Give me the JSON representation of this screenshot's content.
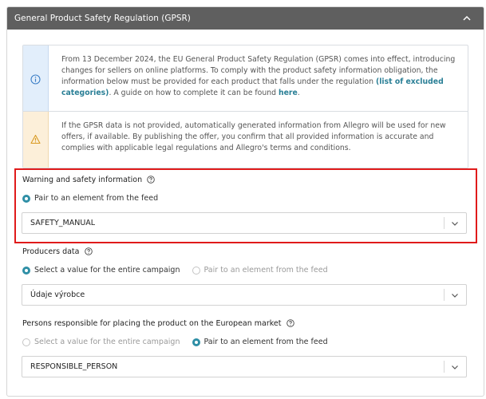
{
  "panel": {
    "title": "General Product Safety Regulation (GPSR)"
  },
  "info_notice": {
    "text_before": "From 13 December 2024, the EU General Product Safety Regulation (GPSR) comes into effect, introducing changes for sellers on online platforms. To comply with the product safety information obligation, the information below must be provided for each product that falls under the regulation ",
    "link_excluded": "(list of excluded categories)",
    "text_middle": ". A guide on how to complete it can be found ",
    "link_here": "here",
    "text_after": "."
  },
  "warning_notice": {
    "text": "If the GPSR data is not provided, automatically generated information from Allegro will be used for new offers, if available. By publishing the offer, you confirm that all provided information is accurate and complies with applicable legal regulations and Allegro's terms and conditions."
  },
  "safety_info": {
    "label": "Warning and safety information",
    "radio_pair": "Pair to an element from the feed",
    "selected_value": "SAFETY_MANUAL"
  },
  "producers": {
    "label": "Producers data",
    "radio_entire": "Select a value for the entire campaign",
    "radio_pair": "Pair to an element from the feed",
    "selected_value": "Údaje výrobce"
  },
  "responsible": {
    "label": "Persons responsible for placing the product on the European market",
    "radio_entire": "Select a value for the entire campaign",
    "radio_pair": "Pair to an element from the feed",
    "selected_value": "RESPONSIBLE_PERSON"
  },
  "colors": {
    "header_bg": "#5f5f5f",
    "accent": "#2f8fa6",
    "highlight": "#e01b1b",
    "info_bg": "#e2eefb",
    "warning_bg": "#fcefd9"
  },
  "icons": {
    "collapse": "chevron-up-icon",
    "info": "info-icon",
    "warning": "warning-icon",
    "help": "question-circle-icon",
    "dropdown": "chevron-down-icon"
  }
}
